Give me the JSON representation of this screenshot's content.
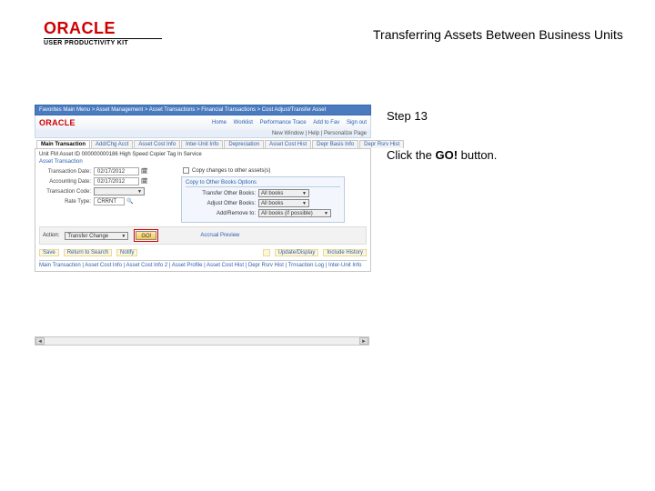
{
  "brand": {
    "name": "ORACLE",
    "sub": "USER PRODUCTIVITY KIT"
  },
  "page": {
    "title": "Transferring Assets Between Business Units"
  },
  "instruction": {
    "step": "Step 13",
    "lead": "Click the ",
    "bold": "GO!",
    "tail": " button."
  },
  "app": {
    "topbar_left": "Favorites   Main Menu > Asset Management > Asset Transactions > Financial Transactions > Cost Adjust/Transfer Asset",
    "topbar_right": "",
    "brand": "ORACLE",
    "header_links": [
      "Home",
      "Worklist",
      "Performance Trace",
      "Add to Fav",
      "Sign out"
    ],
    "subheader": "New Window  |  Help  |  Personalize Page",
    "tabs": [
      {
        "label": "Main Transaction",
        "active": true
      },
      {
        "label": "Add/Chg Acct",
        "active": false
      },
      {
        "label": "Asset Cost Info",
        "active": false
      },
      {
        "label": "Inter-Unit Info",
        "active": false
      },
      {
        "label": "Depreciation",
        "active": false
      },
      {
        "label": "Asset Cost Hist",
        "active": false
      },
      {
        "label": "Depr Basis Info",
        "active": false
      },
      {
        "label": "Depr Rsrv Hist",
        "active": false
      }
    ],
    "id_row": "Unit   FM    Asset ID  000000000186   High Speed Copier        Tag                In Service",
    "section": "Asset Transaction",
    "fields": {
      "trans_date": {
        "label": "Transaction Date:",
        "value": "02/17/2012"
      },
      "acctg_date": {
        "label": "Accounting Date:",
        "value": "02/17/2012"
      },
      "trans_code": {
        "label": "Transaction Code:",
        "value": ""
      },
      "rate_type": {
        "label": "Rate Type:",
        "value": "CRRNT"
      },
      "copy_chg": "Copy changes to other assets(s)"
    },
    "copybox": {
      "title": "Copy to Other Books Options",
      "rows": [
        {
          "label": "Transfer Other Books:",
          "value": "All books"
        },
        {
          "label": "Adjust Other Books:",
          "value": "All books"
        },
        {
          "label": "Add/Remove to:",
          "value": "All books (if possible)"
        }
      ]
    },
    "action_label": "Action:",
    "action_value": "Transfer Change",
    "go_label": "GO!",
    "go_side": "Accrual Preview",
    "btnbar": [
      "Save",
      "Return to Search",
      "Notify"
    ],
    "btnbar_right": [
      "Update/Display",
      "Include History"
    ],
    "footer": "Main Transaction | Asset Cost Info | Asset Cost Info 2 | Asset Profile | Asset Cost Hist | Depr Rsrv Hist | Trnsaction Log | Inter-Unit Info"
  }
}
